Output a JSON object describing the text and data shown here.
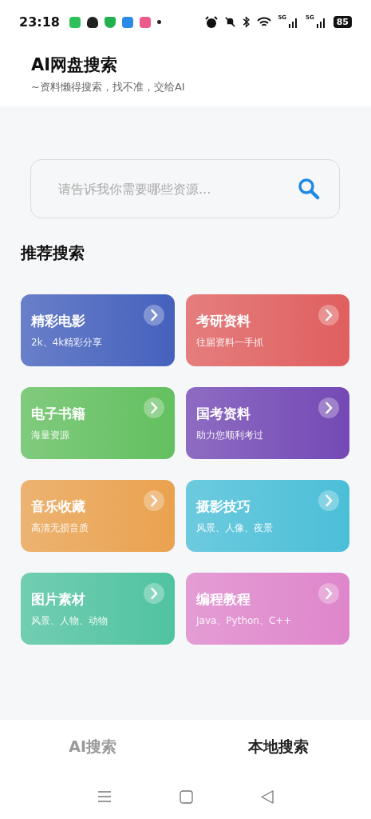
{
  "status_bar": {
    "time": "23:18",
    "network_labels": [
      "5G",
      "5G"
    ],
    "battery": "85"
  },
  "header": {
    "title": "AI网盘搜索",
    "subtitle": "~资料懒得搜索，找不准，交给AI"
  },
  "search": {
    "placeholder": "请告诉我你需要哪些资源..."
  },
  "section_title": "推荐搜索",
  "categories": [
    {
      "title": "精彩电影",
      "subtitle": "2k、4k精彩分享",
      "color": "#4561bd"
    },
    {
      "title": "考研资料",
      "subtitle": "往届资料一手抓",
      "color": "#e05f5f"
    },
    {
      "title": "电子书籍",
      "subtitle": "海量资源",
      "color": "#63c05f"
    },
    {
      "title": "国考资料",
      "subtitle": "助力您顺利考过",
      "color": "#7449b5"
    },
    {
      "title": "音乐收藏",
      "subtitle": "高清无损音质",
      "color": "#eaa24f"
    },
    {
      "title": "摄影技巧",
      "subtitle": "风景、人像、夜景",
      "color": "#4bbfd8"
    },
    {
      "title": "图片素材",
      "subtitle": "风景、人物、动物",
      "color": "#50c3a0"
    },
    {
      "title": "编程教程",
      "subtitle": "Java、Python、C++",
      "color": "#df86cb"
    }
  ],
  "tabs": [
    {
      "label": "AI搜索",
      "selected": false
    },
    {
      "label": "本地搜索",
      "selected": true
    }
  ]
}
